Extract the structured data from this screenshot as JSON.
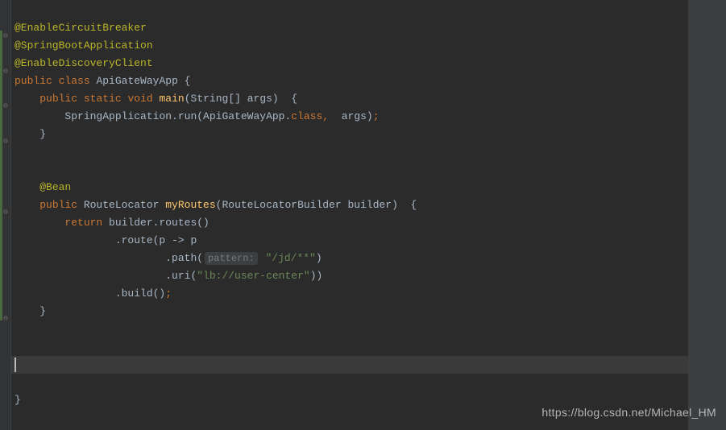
{
  "code": {
    "line1": "",
    "ann1": "@EnableCircuitBreaker",
    "ann2": "@SpringBootApplication",
    "ann3": "@EnableDiscoveryClient",
    "cls_public": "public",
    "cls_class": "class",
    "cls_name": "ApiGateWayApp",
    "cls_brace": " {",
    "main_public": "public",
    "main_static": "static",
    "main_void": "void",
    "main_name": "main",
    "main_params": "(String[] args)",
    "main_brace": "  {",
    "run_pre": "SpringApplication.run(ApiGateWayApp.",
    "run_class": "class",
    "run_comma": ",",
    "run_args": "  args)",
    "run_semi": ";",
    "close_brace": "}",
    "bean_ann": "@Bean",
    "routes_public": "public",
    "routes_type": " RouteLocator ",
    "routes_name": "myRoutes",
    "routes_params": "(RouteLocatorBuilder builder)",
    "routes_brace": "  {",
    "return_kw": "return",
    "return_rest": " builder.routes()",
    "route_line": ".route(p -> p",
    "path_pre": ".path(",
    "path_hint": "pattern:",
    "path_str": "\"/jd/**\"",
    "path_close": ")",
    "uri_pre": ".uri(",
    "uri_str": "\"lb://user-center\"",
    "uri_close": "))",
    "build_line": ".build()",
    "build_semi": ";",
    "final_brace": "}"
  },
  "watermark": "https://blog.csdn.net/Michael_HM"
}
